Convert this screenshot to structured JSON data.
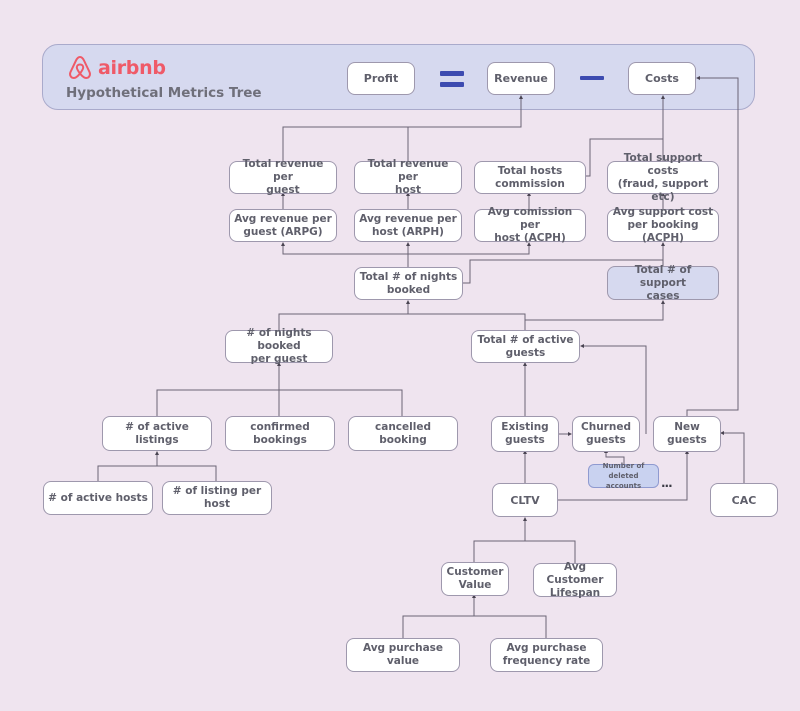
{
  "header": {
    "brand": "airbnb",
    "subtitle": "Hypothetical Metrics Tree",
    "brand_color": "#ef5a68",
    "operator_color": "#3d4bb0",
    "equation": {
      "left": "Profit",
      "equals_icon": "equals-sign",
      "middle": "Revenue",
      "minus_icon": "minus-sign",
      "right": "Costs"
    }
  },
  "nodes": {
    "total_rev_guest": "Total revenue per\nguest",
    "total_rev_host": "Total revenue per\nhost",
    "total_hosts_commission": "Total hosts\ncommission",
    "total_support_costs": "Total support costs\n(fraud, support etc)",
    "arpg": "Avg revenue per\nguest (ARPG)",
    "arph": "Avg revenue per\nhost (ARPH)",
    "acph_commission": "Avg comission per\nhost (ACPH)",
    "acph_support": "Avg support cost\nper booking (ACPH)",
    "total_nights": "Total # of nights\nbooked",
    "total_support_cases": "Total # of support\ncases",
    "nights_per_guest": "# of nights booked\nper guest",
    "total_active_guests": "Total # of active\nguests",
    "active_listings": "# of active listings",
    "confirmed_bookings": "confirmed bookings",
    "cancelled_booking": "cancelled booking",
    "existing_guests": "Existing\nguests",
    "churned_guests": "Churned\nguests",
    "new_guests": "New guests",
    "deleted_accounts": "Number of deleted\naccounts",
    "ellipsis": "...",
    "active_hosts": "# of active hosts",
    "listing_per_host": "# of listing per host",
    "cltv": "CLTV",
    "cac": "CAC",
    "customer_value": "Customer\nValue",
    "avg_lifespan": "Avg Customer\nLifespan",
    "avg_purchase_value": "Avg purchase value",
    "avg_purchase_freq": "Avg purchase\nfrequency rate"
  },
  "colors": {
    "background": "#efe4ef",
    "header_fill": "#d6d9ef",
    "highlight_fill": "#d6d9ef",
    "deleted_fill": "#c9d2f0",
    "connector": "#6b6474",
    "node_text": "#5f5f6b"
  }
}
